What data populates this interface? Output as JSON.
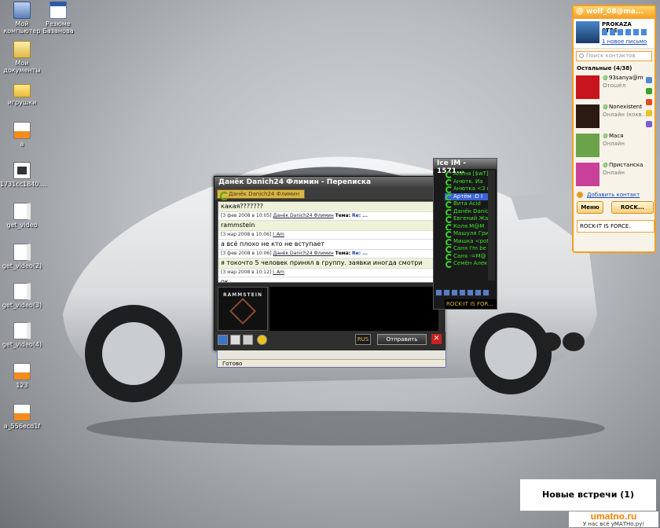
{
  "desktop": {
    "icons": [
      {
        "label": "Мой компьютер"
      },
      {
        "label": "Резюме Базанова"
      },
      {
        "label": "Мои документы"
      },
      {
        "label": "игрушки"
      },
      {
        "label": "a"
      },
      {
        "label": "1731cc1840...."
      },
      {
        "label": "get_video"
      },
      {
        "label": "get_video(2)"
      },
      {
        "label": "get_video(3)"
      },
      {
        "label": "get_video(4)"
      },
      {
        "label": "123"
      },
      {
        "label": "a_556ecd1f"
      }
    ]
  },
  "chat": {
    "title": "Данёк Danich24 Флимин - Переписка",
    "tab": "Данёк Danich24 Флимин",
    "messages": [
      {
        "type": "in",
        "text": "какая???????"
      },
      {
        "type": "hdr",
        "date": "[3 фев 2008 в 10:05]",
        "user": "Данёк Danich24 Флимин",
        "topic_label": "Тема:",
        "topic": "Re: ..."
      },
      {
        "type": "in",
        "text": "rammstein"
      },
      {
        "type": "hdr",
        "date": "[3 мар 2008 в 10:06]",
        "user": "I_Am",
        "topic_label": "",
        "topic": ""
      },
      {
        "type": "out",
        "text": "а всё плохо не кто не вступает"
      },
      {
        "type": "hdr",
        "date": "[3 фев 2008 в 10:06]",
        "user": "Данёк Danich24 Флимин",
        "topic_label": "Тема:",
        "topic": "Re: ..."
      },
      {
        "type": "in",
        "text": "я токочто 5 человек принял в группу. заявки иногда смотри"
      },
      {
        "type": "hdr",
        "date": "[3 мар 2008 в 10:12]",
        "user": "I_Am",
        "topic_label": "",
        "topic": ""
      },
      {
        "type": "out",
        "text": "ок"
      }
    ],
    "avatar_label": "RAMMSTEIN",
    "lang": "RUS",
    "send_label": "Отправить",
    "close_label": "✕",
    "status": "Готово"
  },
  "ice": {
    "title": "Ice IM - 1571...",
    "contacts": [
      {
        "name": "Алёна [$wT]",
        "selected": false
      },
      {
        "name": "Анютк. Йа",
        "selected": false
      },
      {
        "name": "Анютка <3 п",
        "selected": false
      },
      {
        "name": "Артём :D I",
        "selected": true
      },
      {
        "name": "Вита Acid",
        "selected": false
      },
      {
        "name": "Данёк Danic",
        "selected": false
      },
      {
        "name": "Евгений Жа",
        "selected": false
      },
      {
        "name": "Коля M@M",
        "selected": false
      },
      {
        "name": "Машуля Гри",
        "selected": false
      },
      {
        "name": "Мишка <pot",
        "selected": false
      },
      {
        "name": "Саня I'm be",
        "selected": false
      },
      {
        "name": "Саня -=M@",
        "selected": false
      },
      {
        "name": "Семён Алек",
        "selected": false
      }
    ],
    "footer": "ROCK-IT IS FOR..."
  },
  "mail_agent": {
    "title": "wolf_08@ma...",
    "profile_name": "PROKAZA STRE...",
    "new_mail": "1 новое письмо",
    "search_placeholder": "Поиск контактов",
    "group": "Остальные (4/38)",
    "contacts": [
      {
        "name": "93sanya@m",
        "status": "Отошёл",
        "color": "#c7151f"
      },
      {
        "name": "Nonexistent",
        "status": "Онлайн (кокв...",
        "color": "#2b1a12"
      },
      {
        "name": "Мася",
        "status": "Онлайн",
        "color": "#6aa34a"
      },
      {
        "name": "Пристанска",
        "status": "Онлайн",
        "color": "#c9409a"
      }
    ],
    "add_contact": "Добавить контакт",
    "menu_label": "Меню",
    "rock_label": "ROCK...",
    "ticker": "ROCK-IT IS FORCE."
  },
  "notification": {
    "text": "Новые встречи (1)"
  },
  "brand": {
    "name": "umatno.ru",
    "slogan": "У нас всё уМАТНо.ру!"
  }
}
